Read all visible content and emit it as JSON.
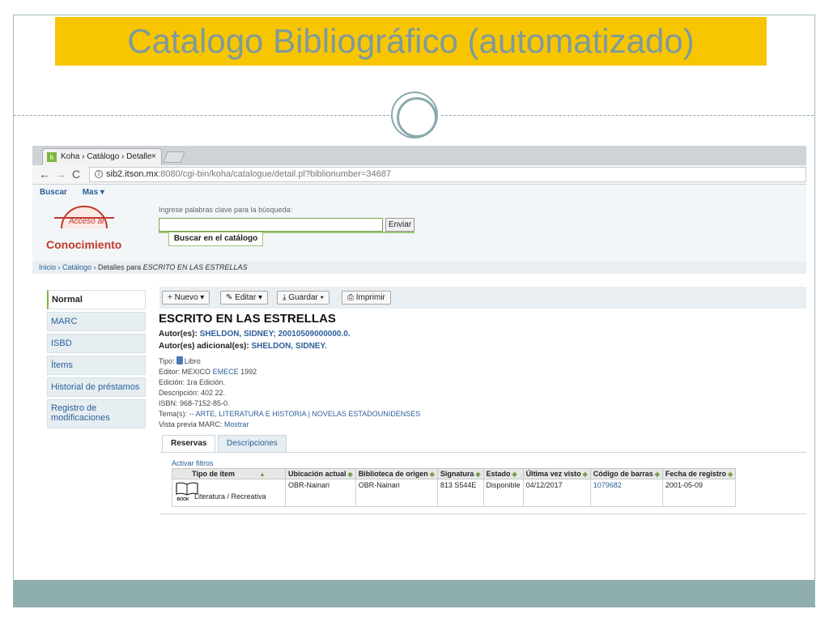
{
  "slide": {
    "title": "Catalogo Bibliográfico (automatizado)",
    "colors": {
      "title_bg": "#f7c600",
      "title_text": "#7f9a9c",
      "accent": "#8faeae"
    }
  },
  "browser": {
    "tab_title": "Koha › Catálogo › Detalle",
    "tab_close": "×",
    "url_host": "sib2.itson.mx",
    "url_path": ":8080/cgi-bin/koha/catalogue/detail.pl?biblionumber=34687"
  },
  "koha": {
    "menu": {
      "search": "Buscar",
      "more": "Mas ▾"
    },
    "logo": {
      "small": "Acceso al",
      "big": "Conocimiento"
    },
    "search": {
      "label": "Ingrese palabras clave para la búsqueda:",
      "button": "Enviar",
      "tab": "Buscar en el catálogo"
    },
    "breadcrumb": {
      "home": "Inicio",
      "catalog": "Catálogo",
      "details": "Detalles para",
      "current": "ESCRITO EN LAS ESTRELLAS"
    },
    "nav": [
      {
        "label": "Normal"
      },
      {
        "label": "MARC"
      },
      {
        "label": "ISBD"
      },
      {
        "label": "Ítems"
      },
      {
        "label": "Historial de préstamos"
      },
      {
        "label": "Registro de modificaciones"
      }
    ],
    "toolbar": {
      "new": "+ Nuevo ▾",
      "edit": "✎ Editar ▾",
      "save": "⤓ Guardar ▾",
      "print": "⎙ Imprimir"
    },
    "record": {
      "title": "ESCRITO EN LAS ESTRELLAS",
      "authors_label": "Autor(es):",
      "authors": "SHELDON, SIDNEY; 20010509000000.0.",
      "addl_label": "Autor(es) adicional(es):",
      "addl": "SHELDON, SIDNEY.",
      "type_label": "Tipo:",
      "type": "Libro",
      "publisher_label": "Editor:",
      "publisher": "MEXICO",
      "publisher_link": "EMECE",
      "publisher_year": "1992",
      "edition": "Edición: 1ra Edición.",
      "description": "Descripción: 402 22.",
      "isbn": "ISBN: 968-7152-85-0.",
      "subjects_label": "Tema(s):",
      "subjects": "-- ARTE, LITERATURA E HISTORIA | NOVELAS ESTADOUNIDENSES",
      "marc_label": "Vista previa MARC:",
      "marc_link": "Mostrar"
    },
    "tabs": {
      "holds": "Reservas",
      "descriptions": "Descripciones"
    },
    "filters": "Activar filtros",
    "table": {
      "headers": [
        "Tipo de ítem",
        "Ubicación actual",
        "Biblioteca de origen",
        "Signatura",
        "Estado",
        "Última vez visto",
        "Código de barras",
        "Fecha de registro"
      ],
      "sort_arrows": [
        "▲",
        "◆",
        "◆",
        "◆",
        "◆",
        "◆",
        "◆",
        "◆"
      ],
      "rows": [
        {
          "book_label": "BOOK",
          "type": "Literatura / Recreativa",
          "location": "OBR-Nainari",
          "home": "OBR-Nainari",
          "callno": "813 S544E",
          "status": "Disponible",
          "seen": "04/12/2017",
          "barcode": "1079682",
          "date": "2001-05-09"
        }
      ]
    }
  }
}
